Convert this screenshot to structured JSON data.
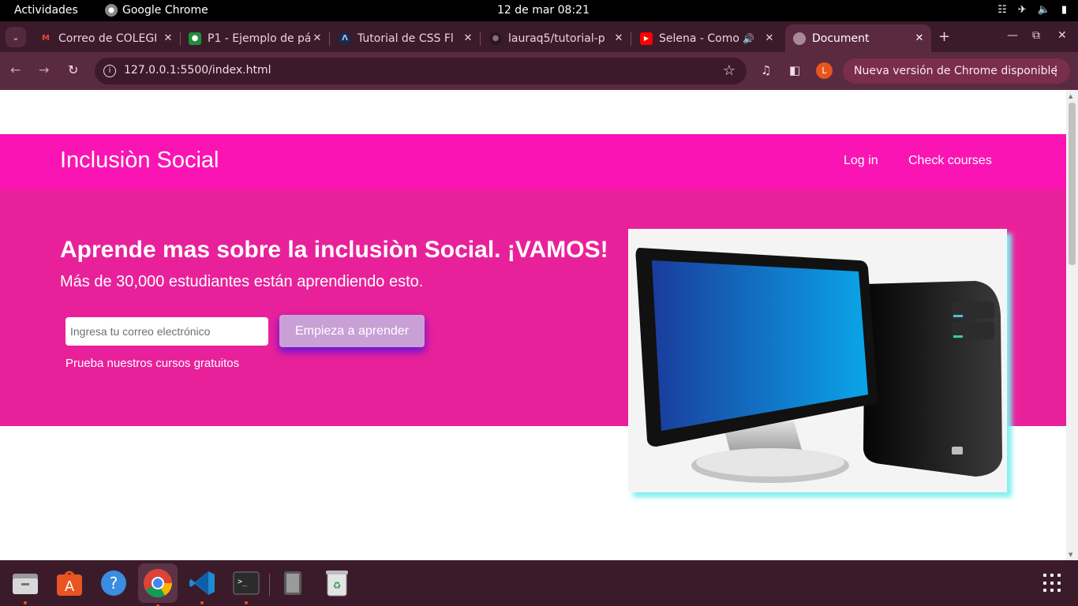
{
  "system_bar": {
    "activities": "Actividades",
    "app_name": "Google Chrome",
    "clock": "12 de mar  08:21"
  },
  "tabs": [
    {
      "title": "Correo de COLEGI",
      "icon": "gmail-icon"
    },
    {
      "title": "P1 - Ejemplo de pá",
      "icon": "classroom-icon"
    },
    {
      "title": "Tutorial de CSS Fl",
      "icon": "tutorial-site-icon"
    },
    {
      "title": "lauraq5/tutorial-p",
      "icon": "github-icon"
    },
    {
      "title": "Selena - Como",
      "icon": "youtube-icon"
    },
    {
      "title": "Document",
      "icon": "globe-icon",
      "active": true
    }
  ],
  "toolbar": {
    "url": "127.0.0.1:5500/index.html",
    "profile_initial": "L",
    "update_label": "Nueva versión de Chrome disponible"
  },
  "page": {
    "brand": "Inclusiòn Social",
    "nav": {
      "login": "Log in",
      "courses": "Check courses"
    },
    "hero": {
      "heading": "Aprende mas sobre la inclusiòn Social. ¡VAMOS!",
      "subtitle": "Más de 30,000 estudiantes están aprendiendo esto.",
      "email_placeholder": "Ingresa tu correo electrónico",
      "cta": "Empieza a aprender",
      "free_courses": "Prueba nuestros cursos gratuitos"
    },
    "colors": {
      "navbar": "#fa14b4",
      "hero": "#e8219a",
      "cta": "#c8a0d6",
      "image_shadow": "#7ff0ee"
    }
  },
  "dock": [
    "files-icon",
    "app-center-icon",
    "help-icon",
    "chrome-icon",
    "vscode-icon",
    "terminal-icon",
    "device-icon",
    "trash-icon",
    "show-apps-icon"
  ]
}
